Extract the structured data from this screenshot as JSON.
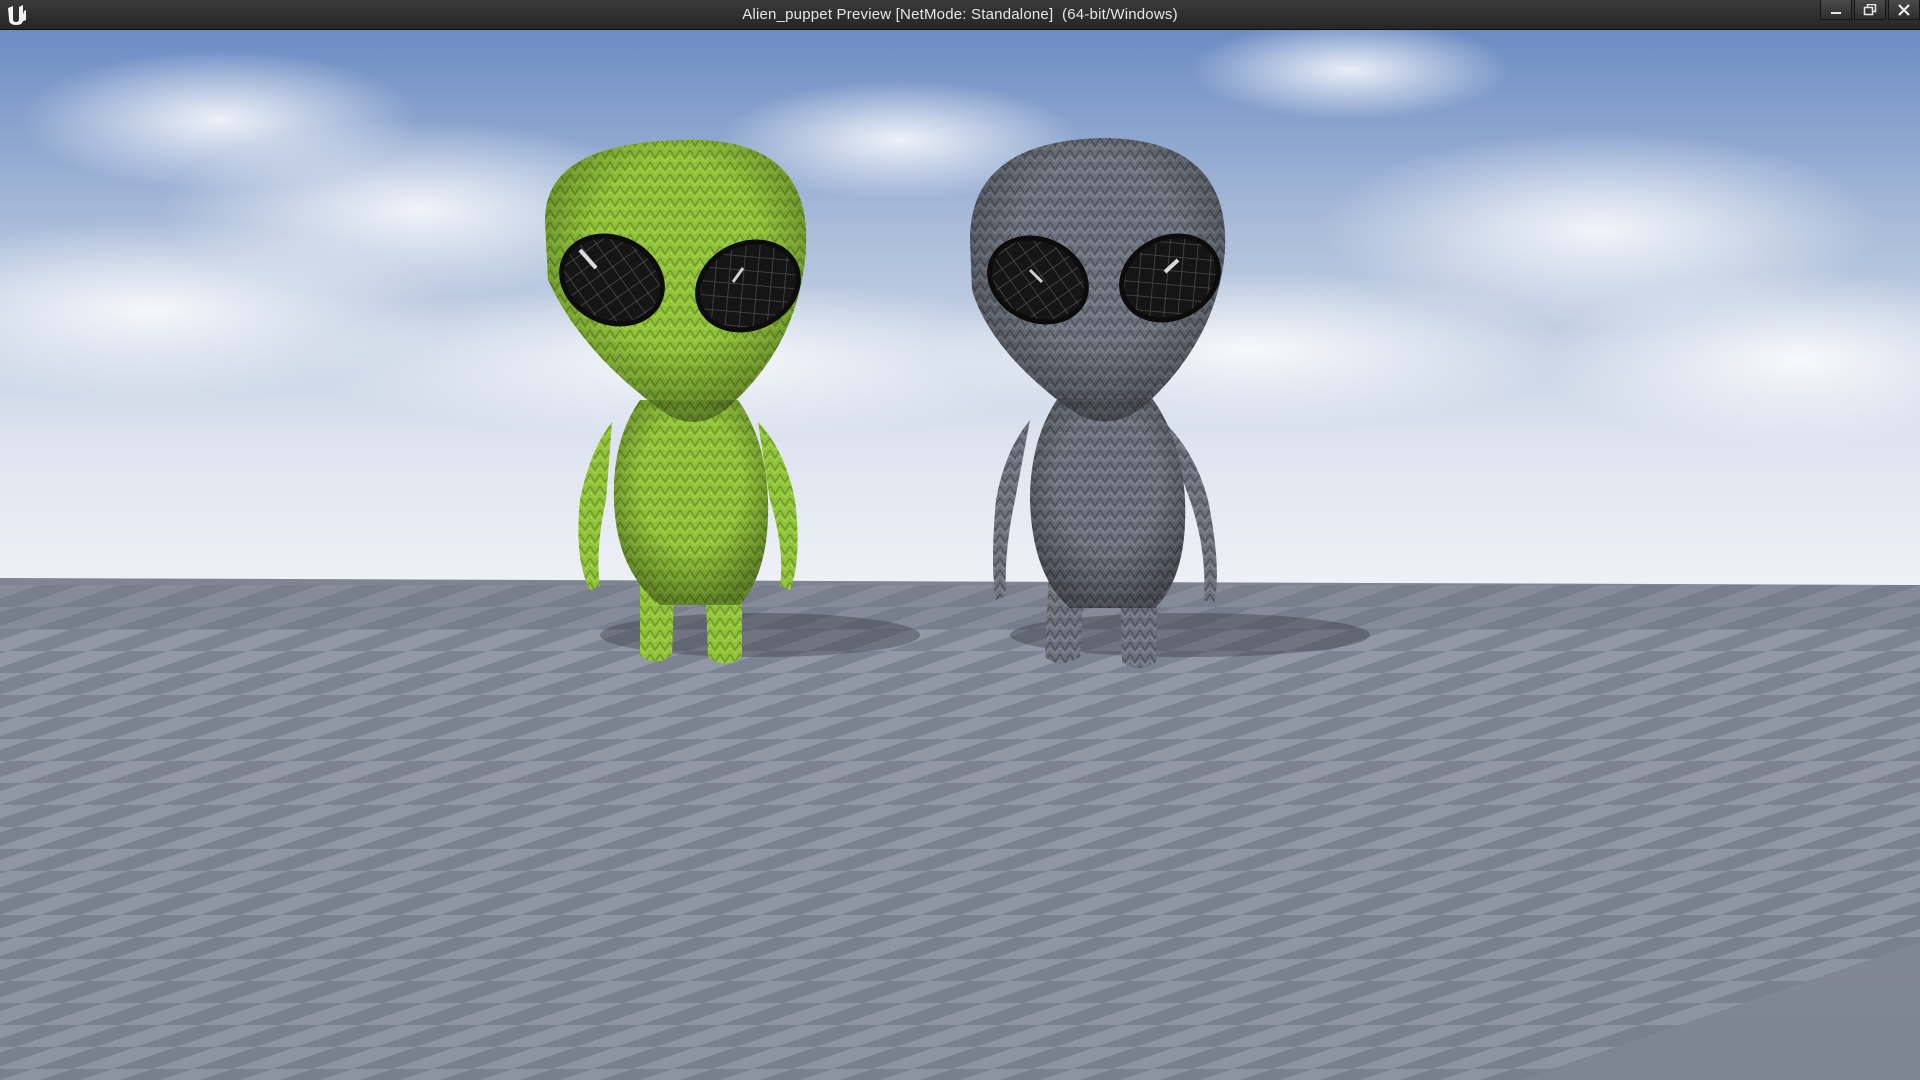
{
  "window": {
    "title": "Alien_puppet Preview [NetMode: Standalone]  (64-bit/Windows)",
    "controls": {
      "minimize_icon": "minimize-icon",
      "restore_icon": "restore-icon",
      "close_icon": "close-icon"
    },
    "logo_icon": "unreal-engine-logo-icon"
  },
  "scene": {
    "sky_color_top": "#6f8fc4",
    "sky_color_horizon": "#e9edf4",
    "floor_light": "#8f97a6",
    "floor_dark": "#6d7483",
    "characters": [
      {
        "name": "green-alien-puppet",
        "color": "#94c43a"
      },
      {
        "name": "gray-alien-puppet",
        "color": "#6b7079"
      }
    ]
  }
}
